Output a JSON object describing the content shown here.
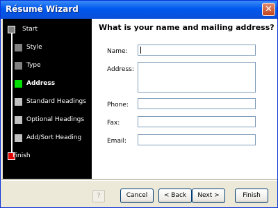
{
  "window": {
    "title": "Résumé Wizard",
    "close_symbol": "✕"
  },
  "steps": [
    {
      "label": "Start",
      "state": "done"
    },
    {
      "label": "Style",
      "state": "done"
    },
    {
      "label": "Type",
      "state": "done"
    },
    {
      "label": "Address",
      "state": "current"
    },
    {
      "label": "Standard Headings",
      "state": "todo"
    },
    {
      "label": "Optional Headings",
      "state": "todo"
    },
    {
      "label": "Add/Sort Heading",
      "state": "todo"
    },
    {
      "label": "Finish",
      "state": "end"
    }
  ],
  "content": {
    "heading": "What is your name and mailing address?",
    "fields": {
      "name": {
        "label": "Name:",
        "value": ""
      },
      "address": {
        "label": "Address:",
        "value": ""
      },
      "phone": {
        "label": "Phone:",
        "value": ""
      },
      "fax": {
        "label": "Fax:",
        "value": ""
      },
      "email": {
        "label": "Email:",
        "value": ""
      }
    }
  },
  "buttons": {
    "help_symbol": "?",
    "cancel": "Cancel",
    "back": "< Back",
    "next": "Next >",
    "finish": "Finish"
  },
  "colors": {
    "current_step": "#00E000",
    "finish_step": "#E00000",
    "completed_step": "#808080",
    "pending_step": "#C0C0C0",
    "titlebar": "#0058EE"
  }
}
